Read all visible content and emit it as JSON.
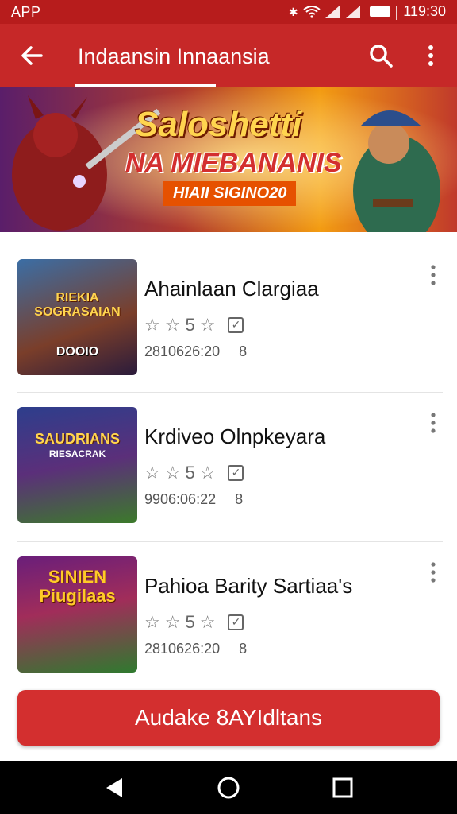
{
  "status_bar": {
    "left_text": "APP",
    "time": "119:30",
    "icons": [
      "bluetooth-icon",
      "wifi-icon",
      "signal-icon",
      "battery-icon"
    ]
  },
  "toolbar": {
    "title": "Indaansin Innaansia",
    "back_icon": "arrow-left-icon",
    "search_icon": "search-icon",
    "more_icon": "more-vert-icon"
  },
  "banner": {
    "headline": "Saloshetti",
    "subheadline": "NA MIEBANANIS",
    "tagline": "HIAII SIGINO20"
  },
  "games": [
    {
      "title": "Ahainlaan Clargiaa",
      "rating_text": "5",
      "meta": "2810626:20",
      "art_title": "RIEKIA SOGRASAIAN",
      "art_caption": "DOOIO"
    },
    {
      "title": "Krdiveo Olnpkeyara",
      "rating_text": "5",
      "meta": "9906:06:22",
      "art_title": "SAUDRIANS",
      "art_caption": "RIESACRAK"
    },
    {
      "title": "Pahioa Barity Sartiaa's",
      "rating_text": "5",
      "meta": "2810626:20",
      "art_title": "SINIEN Piugilaas",
      "art_caption": ""
    }
  ],
  "cta": {
    "label": "Audake 8AYIdltans"
  },
  "colors": {
    "primary": "#c62828",
    "status": "#b71c1c",
    "button": "#d32f2f"
  }
}
